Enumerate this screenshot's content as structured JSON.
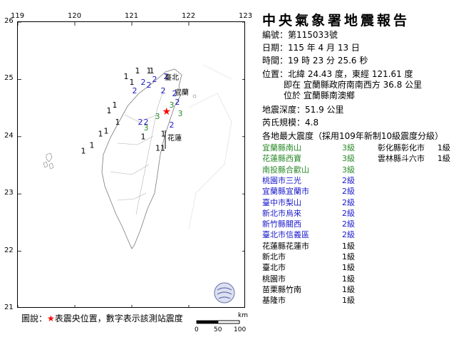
{
  "report": {
    "title": "中央氣象署地震報告",
    "number_label": "編號：",
    "number": "第115033號",
    "date_label": "日期：",
    "date": "115 年 4 月 13 日",
    "time_label": "時間：",
    "time": "19 時 23 分 25.6 秒",
    "location_label": "位置：",
    "location": "北緯 24.43 度，東經 121.61 度",
    "location_desc": "即在 宜蘭縣政府南南西方 36.8 公里",
    "location_in": "位於 宜蘭縣南澳鄉",
    "depth_label": "地震深度：",
    "depth": "51.9 公里",
    "magnitude_label": "芮氏規模：",
    "magnitude": "4.8",
    "intensity_heading": "各地最大震度（採用109年新制10級震度分級）"
  },
  "colors": {
    "grade3": "#2a8a2a",
    "grade2": "#1a1acc",
    "grade1": "#000000",
    "epicenter": "#ff0000"
  },
  "intensities_left": [
    {
      "place": "宜蘭縣南山",
      "grade": "3級",
      "level": 3
    },
    {
      "place": "花蓮縣西寶",
      "grade": "3級",
      "level": 3
    },
    {
      "place": "南投縣合歡山",
      "grade": "3級",
      "level": 3
    },
    {
      "place": "桃園市三光",
      "grade": "2級",
      "level": 2
    },
    {
      "place": "宜蘭縣宜蘭市",
      "grade": "2級",
      "level": 2
    },
    {
      "place": "臺中市梨山",
      "grade": "2級",
      "level": 2
    },
    {
      "place": "新北市烏來",
      "grade": "2級",
      "level": 2
    },
    {
      "place": "新竹縣關西",
      "grade": "2級",
      "level": 2
    },
    {
      "place": "臺北市信義區",
      "grade": "2級",
      "level": 2
    },
    {
      "place": "花蓮縣花蓮市",
      "grade": "1級",
      "level": 1
    },
    {
      "place": "新北市",
      "grade": "1級",
      "level": 1
    },
    {
      "place": "臺北市",
      "grade": "1級",
      "level": 1
    },
    {
      "place": "桃園市",
      "grade": "1級",
      "level": 1
    },
    {
      "place": "苗栗縣竹南",
      "grade": "1級",
      "level": 1
    },
    {
      "place": "基隆市",
      "grade": "1級",
      "level": 1
    }
  ],
  "intensities_right": [
    {
      "place": "彰化縣彰化市",
      "grade": "1級",
      "level": 1
    },
    {
      "place": "雲林縣斗六市",
      "grade": "1級",
      "level": 1
    }
  ],
  "map": {
    "lon_ticks": [
      "119",
      "120",
      "121",
      "122",
      "123"
    ],
    "lat_ticks": [
      "26",
      "25",
      "24",
      "23",
      "22",
      "21"
    ],
    "city_yilan": "宜蘭",
    "city_hualien": "花蓮",
    "city_taipei": "臺北",
    "stations": [
      {
        "lon": 121.7,
        "lat": 24.55,
        "v": "3",
        "level": 3
      },
      {
        "lon": 121.45,
        "lat": 24.35,
        "v": "3",
        "level": 3
      },
      {
        "lon": 121.25,
        "lat": 24.15,
        "v": "3",
        "level": 3
      },
      {
        "lon": 121.8,
        "lat": 24.6,
        "v": "2",
        "level": 2
      },
      {
        "lon": 121.75,
        "lat": 24.75,
        "v": "2",
        "level": 2
      },
      {
        "lon": 121.55,
        "lat": 24.8,
        "v": "2",
        "level": 2
      },
      {
        "lon": 121.3,
        "lat": 24.9,
        "v": "2",
        "level": 2
      },
      {
        "lon": 121.05,
        "lat": 24.8,
        "v": "2",
        "level": 2
      },
      {
        "lon": 121.2,
        "lat": 24.95,
        "v": "2",
        "level": 2
      },
      {
        "lon": 121.4,
        "lat": 25.0,
        "v": "2",
        "level": 2
      },
      {
        "lon": 121.6,
        "lat": 25.05,
        "v": "2",
        "level": 2
      },
      {
        "lon": 121.25,
        "lat": 24.25,
        "v": "2",
        "level": 2
      },
      {
        "lon": 121.15,
        "lat": 24.25,
        "v": "2",
        "level": 2
      },
      {
        "lon": 121.85,
        "lat": 24.4,
        "v": "3",
        "level": 3
      },
      {
        "lon": 121.7,
        "lat": 24.2,
        "v": "2",
        "level": 2
      },
      {
        "lon": 121.35,
        "lat": 25.15,
        "v": "1",
        "level": 1
      },
      {
        "lon": 121.1,
        "lat": 25.15,
        "v": "1",
        "level": 1
      },
      {
        "lon": 120.9,
        "lat": 25.05,
        "v": "1",
        "level": 1
      },
      {
        "lon": 121.0,
        "lat": 24.95,
        "v": "1",
        "level": 1
      },
      {
        "lon": 120.7,
        "lat": 24.55,
        "v": "1",
        "level": 1
      },
      {
        "lon": 120.6,
        "lat": 24.45,
        "v": "1",
        "level": 1
      },
      {
        "lon": 120.55,
        "lat": 24.1,
        "v": "1",
        "level": 1
      },
      {
        "lon": 120.45,
        "lat": 24.05,
        "v": "1",
        "level": 1
      },
      {
        "lon": 120.75,
        "lat": 24.25,
        "v": "1",
        "level": 1
      },
      {
        "lon": 120.3,
        "lat": 23.85,
        "v": "1",
        "level": 1
      },
      {
        "lon": 120.15,
        "lat": 23.75,
        "v": "1",
        "level": 1
      },
      {
        "lon": 121.55,
        "lat": 24.05,
        "v": "1",
        "level": 1
      },
      {
        "lon": 121.5,
        "lat": 23.8,
        "v": "11",
        "level": 1
      },
      {
        "lon": 121.2,
        "lat": 24.0,
        "v": "1",
        "level": 1
      },
      {
        "lon": 121.3,
        "lat": 25.15,
        "v": "1",
        "level": 1
      }
    ],
    "epicenter": {
      "lon": 121.61,
      "lat": 24.43
    },
    "scale_unit": "km",
    "scale_ticks": [
      "0",
      "50",
      "100"
    ]
  },
  "legend": {
    "prefix": "圖說：",
    "star": "★",
    "text": "表震央位置，數字表示該測站震度"
  }
}
